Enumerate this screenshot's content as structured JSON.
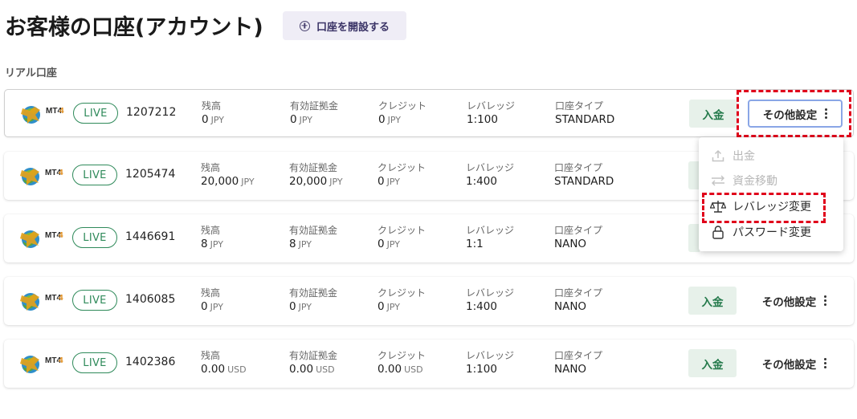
{
  "header": {
    "title": "お客様の口座(アカウント)",
    "open_account_label": "口座を開設する"
  },
  "section_label": "リアル口座",
  "column_labels": {
    "balance": "残高",
    "equity": "有効証拠金",
    "credit": "クレジット",
    "leverage": "レバレッジ",
    "account_type": "口座タイプ"
  },
  "platform_label": "MT4",
  "status_label": "LIVE",
  "buttons": {
    "deposit": "入金",
    "other_settings": "その他設定"
  },
  "accounts": [
    {
      "number": "1207212",
      "balance": "0",
      "equity": "0",
      "credit": "0",
      "currency": "JPY",
      "leverage": "1:100",
      "type": "STANDARD"
    },
    {
      "number": "1205474",
      "balance": "20,000",
      "equity": "20,000",
      "credit": "0",
      "currency": "JPY",
      "leverage": "1:400",
      "type": "STANDARD"
    },
    {
      "number": "1446691",
      "balance": "8",
      "equity": "8",
      "credit": "0",
      "currency": "JPY",
      "leverage": "1:1",
      "type": "NANO"
    },
    {
      "number": "1406085",
      "balance": "0",
      "equity": "0",
      "credit": "0",
      "currency": "JPY",
      "leverage": "1:400",
      "type": "NANO"
    },
    {
      "number": "1402386",
      "balance": "0.00",
      "equity": "0.00",
      "credit": "0.00",
      "currency": "USD",
      "leverage": "1:100",
      "type": "NANO"
    }
  ],
  "dropdown": {
    "items": [
      {
        "label": "出金",
        "icon": "upload-icon",
        "enabled": false
      },
      {
        "label": "資金移動",
        "icon": "transfer-arrows-icon",
        "enabled": false
      },
      {
        "label": "レバレッジ変更",
        "icon": "scale-icon",
        "enabled": true
      },
      {
        "label": "パスワード変更",
        "icon": "lock-icon",
        "enabled": true
      }
    ]
  },
  "colors": {
    "live_green": "#2f8a5a",
    "deposit_bg": "#e7f1ea",
    "deposit_text": "#247a4b",
    "open_account_bg": "#efedf6",
    "highlight_red": "#e0001b",
    "active_border": "#8aa6e6"
  }
}
